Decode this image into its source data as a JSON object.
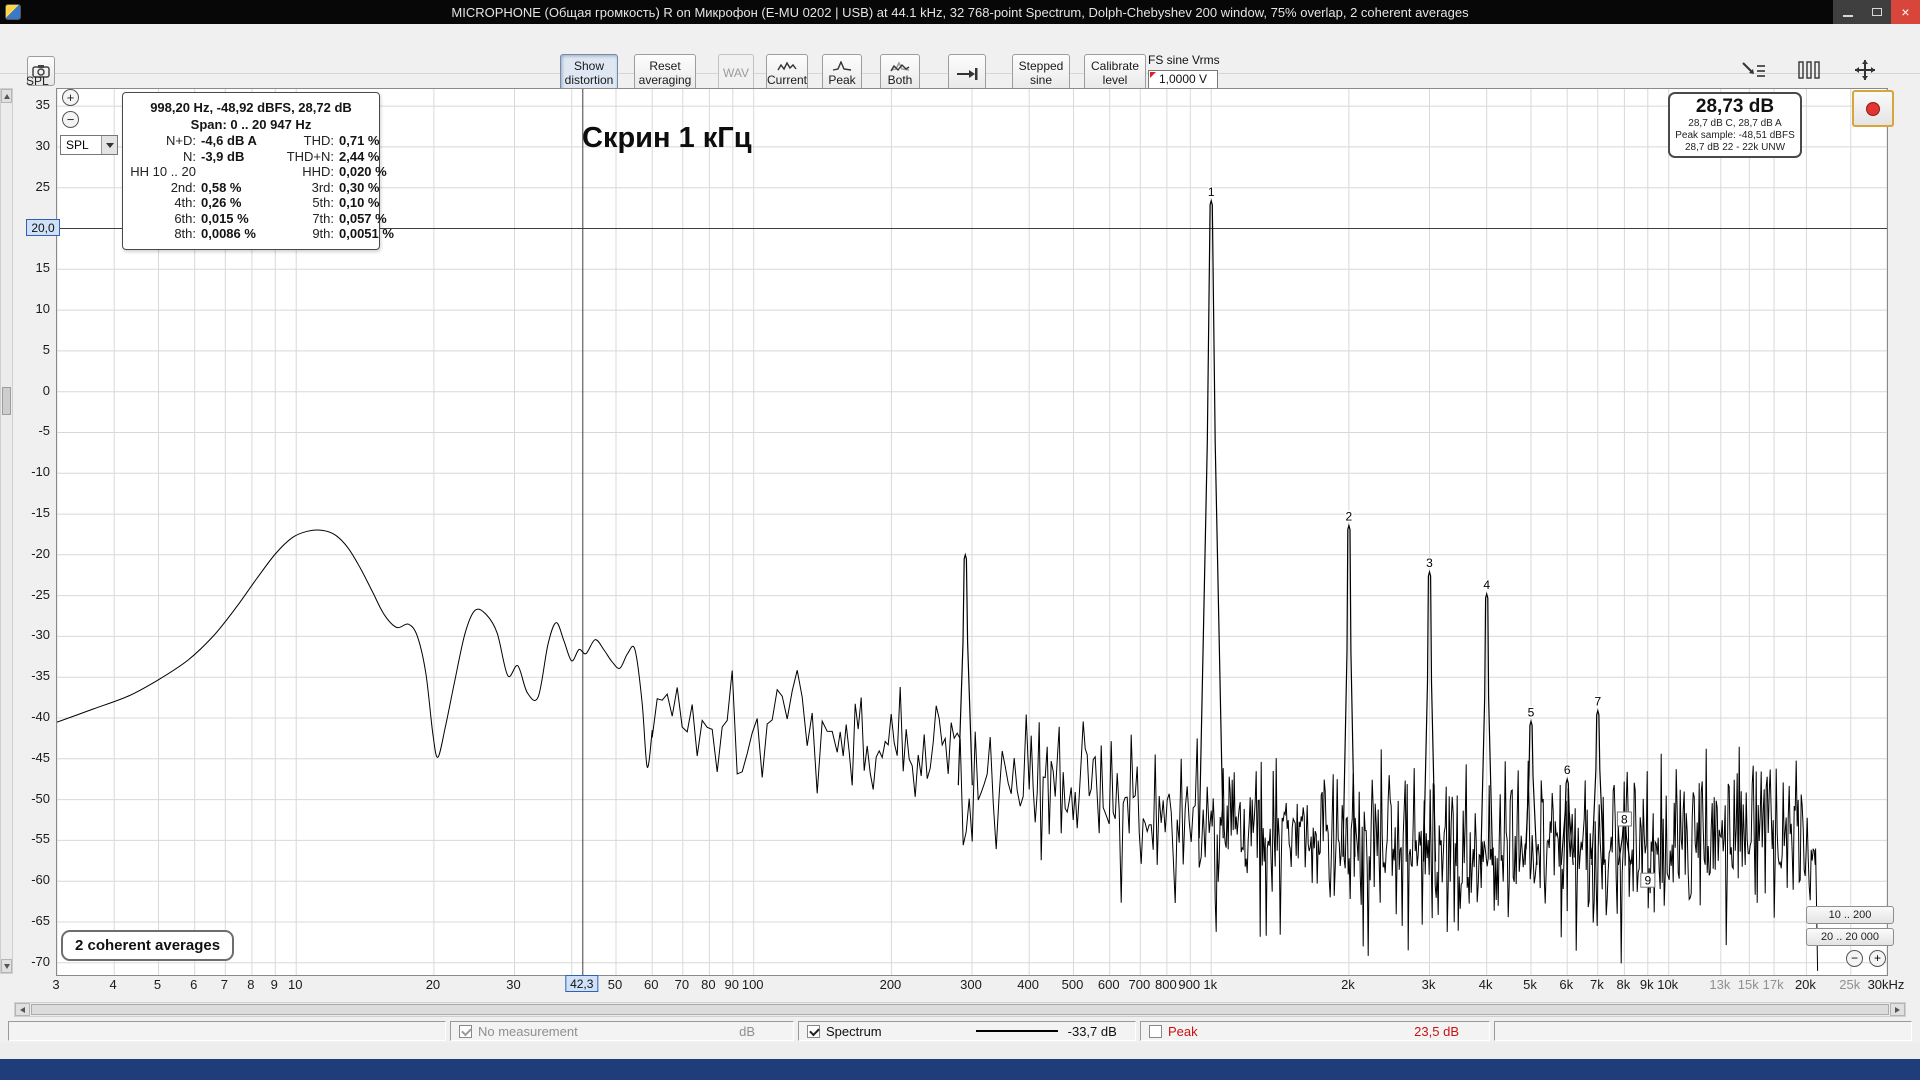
{
  "window": {
    "title": "MICROPHONE (Общая громкость) R on Микрофон (E-MU 0202 | USB) at 44.1 kHz, 32 768-point Spectrum, Dolph-Chebyshev 200 window, 75% overlap, 2 coherent averages"
  },
  "icons": {
    "close": "×",
    "plus": "+",
    "minus": "−"
  },
  "toolbar": {
    "buttons": {
      "show_distortion": "Show distortion",
      "reset_averaging": "Reset averaging",
      "wav": "WAV",
      "current": "Current",
      "peak": "Peak",
      "both": "Both",
      "stepped_sine": "Stepped sine",
      "calibrate_level": "Calibrate level"
    },
    "fs_sine_label": "FS sine Vrms",
    "fs_sine_value": "1,0000 V"
  },
  "left_panel": {
    "axis_title": "SPL",
    "unit_value": "SPL"
  },
  "annotation": "Скрин 1 кГц",
  "averages_label": "2 coherent averages",
  "marker_box": {
    "line1": "998,20 Hz, -48,92 dBFS, 28,72 dB",
    "line2": "Span: 0 .. 20 947 Hz",
    "rows": [
      [
        "N+D:",
        "-4,6 dB A",
        "THD:",
        "0,71 %"
      ],
      [
        "N:",
        "-3,9 dB",
        "THD+N:",
        "2,44 %"
      ],
      [
        "HH 10 .. 20",
        "",
        "HHD:",
        "0,020 %"
      ],
      [
        "2nd:",
        "0,58 %",
        "3rd:",
        "0,30 %"
      ],
      [
        "4th:",
        "0,26 %",
        "5th:",
        "0,10 %"
      ],
      [
        "6th:",
        "0,015 %",
        "7th:",
        "0,057 %"
      ],
      [
        "8th:",
        "0,0086 %",
        "9th:",
        "0,0051 %"
      ]
    ]
  },
  "level_box": {
    "main": "28,73 dB",
    "line1": "28,7 dB C, 28,7 dB A",
    "line2": "Peak sample: -48,51 dBFS",
    "line3": "28,7 dB 22 - 22k UNW"
  },
  "range_buttons": {
    "r1": "10 .. 200",
    "r2": "20 .. 20 000"
  },
  "status_bar": {
    "no_measurement": "No measurement",
    "db_label": "dB",
    "spectrum": "Spectrum",
    "spectrum_value": "-33,7 dB",
    "peak": "Peak",
    "peak_value": "23,5 dB"
  },
  "chart_data": {
    "type": "line",
    "title": "Скрин 1 кГц",
    "xlabel": "Hz",
    "ylabel": "SPL dB",
    "x_scale": "log",
    "x_range_hz": [
      3,
      30000
    ],
    "y_range_db": [
      -70,
      35
    ],
    "y_step_db": 5,
    "grid": true,
    "cursor": {
      "freq_hz": 42.3,
      "freq_label": "42,3",
      "level_db": 20.0,
      "level_label": "20,0"
    },
    "y_ticks": [
      35,
      30,
      25,
      15,
      10,
      5,
      0,
      -5,
      -10,
      -15,
      -20,
      -25,
      -30,
      -35,
      -40,
      -45,
      -50,
      -55,
      -60,
      -65,
      -70
    ],
    "x_ticks": [
      {
        "f": 3,
        "t": "3"
      },
      {
        "f": 4,
        "t": "4"
      },
      {
        "f": 5,
        "t": "5"
      },
      {
        "f": 6,
        "t": "6"
      },
      {
        "f": 7,
        "t": "7"
      },
      {
        "f": 8,
        "t": "8"
      },
      {
        "f": 9,
        "t": "9"
      },
      {
        "f": 10,
        "t": "10"
      },
      {
        "f": 20,
        "t": "20"
      },
      {
        "f": 30,
        "t": "30"
      },
      {
        "f": 50,
        "t": "50"
      },
      {
        "f": 60,
        "t": "60"
      },
      {
        "f": 70,
        "t": "70"
      },
      {
        "f": 80,
        "t": "80"
      },
      {
        "f": 90,
        "t": "90"
      },
      {
        "f": 100,
        "t": "100"
      },
      {
        "f": 200,
        "t": "200"
      },
      {
        "f": 300,
        "t": "300"
      },
      {
        "f": 400,
        "t": "400"
      },
      {
        "f": 500,
        "t": "500"
      },
      {
        "f": 600,
        "t": "600"
      },
      {
        "f": 700,
        "t": "700"
      },
      {
        "f": 800,
        "t": "800"
      },
      {
        "f": 900,
        "t": "900"
      },
      {
        "f": 1000,
        "t": "1k"
      },
      {
        "f": 2000,
        "t": "2k"
      },
      {
        "f": 3000,
        "t": "3k"
      },
      {
        "f": 4000,
        "t": "4k"
      },
      {
        "f": 5000,
        "t": "5k"
      },
      {
        "f": 6000,
        "t": "6k"
      },
      {
        "f": 7000,
        "t": "7k"
      },
      {
        "f": 8000,
        "t": "8k"
      },
      {
        "f": 9000,
        "t": "9k"
      },
      {
        "f": 10000,
        "t": "10k"
      },
      {
        "f": 13000,
        "t": "13k",
        "muted": true
      },
      {
        "f": 15000,
        "t": "15k",
        "muted": true
      },
      {
        "f": 17000,
        "t": "17k",
        "muted": true
      },
      {
        "f": 20000,
        "t": "20k"
      },
      {
        "f": 25000,
        "t": "25k",
        "muted": true
      },
      {
        "f": 30000,
        "t": "30kHz"
      }
    ],
    "harmonics": [
      {
        "n": "1",
        "f": 1000,
        "db": 23.4,
        "boxed": false
      },
      {
        "n": "2",
        "f": 2000,
        "db": -16.4,
        "boxed": false
      },
      {
        "n": "3",
        "f": 3000,
        "db": -22.1,
        "boxed": false
      },
      {
        "n": "4",
        "f": 4000,
        "db": -24.8,
        "boxed": false
      },
      {
        "n": "5",
        "f": 5000,
        "db": -40.4,
        "boxed": false
      },
      {
        "n": "6",
        "f": 6000,
        "db": -47.5,
        "boxed": false
      },
      {
        "n": "7",
        "f": 7000,
        "db": -39.1,
        "boxed": false
      },
      {
        "n": "8",
        "f": 8000,
        "db": -52.5,
        "boxed": true
      },
      {
        "n": "9",
        "f": 9000,
        "db": -60.0,
        "boxed": true
      }
    ],
    "spurs": [
      [
        290,
        -20.0
      ]
    ],
    "smooth_curve": [
      [
        3,
        -40.5
      ],
      [
        3.6,
        -38.9
      ],
      [
        4.3,
        -37.3
      ],
      [
        5,
        -35.3
      ],
      [
        5.8,
        -32.9
      ],
      [
        6.6,
        -29.9
      ],
      [
        7.4,
        -26.4
      ],
      [
        8.2,
        -22.9
      ],
      [
        9,
        -19.9
      ],
      [
        9.8,
        -17.9
      ],
      [
        10.6,
        -17.1
      ],
      [
        11.4,
        -17
      ],
      [
        12.2,
        -17.6
      ],
      [
        13,
        -19.2
      ],
      [
        13.8,
        -21.6
      ],
      [
        14.7,
        -24.6
      ],
      [
        15.6,
        -27.4
      ],
      [
        16.6,
        -28.9
      ],
      [
        17.6,
        -28.5
      ],
      [
        18.4,
        -30
      ],
      [
        19.2,
        -34.5
      ],
      [
        19.9,
        -42
      ],
      [
        20.4,
        -44.8
      ],
      [
        21.2,
        -41
      ],
      [
        22.2,
        -35.5
      ],
      [
        23.4,
        -29.6
      ],
      [
        24.6,
        -26.8
      ],
      [
        26,
        -27.3
      ],
      [
        27.5,
        -29.6
      ],
      [
        29,
        -34.8
      ],
      [
        30.5,
        -33.6
      ],
      [
        32,
        -36.9
      ],
      [
        33.8,
        -37.4
      ],
      [
        35.5,
        -31
      ],
      [
        37,
        -28.3
      ],
      [
        38.5,
        -30.6
      ],
      [
        40,
        -33
      ],
      [
        41.5,
        -31.6
      ],
      [
        43,
        -32.1
      ],
      [
        45,
        -30.4
      ],
      [
        47,
        -31.6
      ],
      [
        49,
        -33.1
      ],
      [
        51,
        -33.9
      ],
      [
        53,
        -32.1
      ],
      [
        55,
        -31.6
      ],
      [
        57,
        -38
      ],
      [
        58.5,
        -46
      ],
      [
        60,
        -41.5
      ]
    ],
    "noise_envelope": [
      [
        60,
        -38,
        7
      ],
      [
        80,
        -40,
        7.5
      ],
      [
        100,
        -41,
        8
      ],
      [
        140,
        -42,
        8
      ],
      [
        200,
        -44,
        8
      ],
      [
        280,
        -45,
        8
      ],
      [
        350,
        -46.5,
        8
      ],
      [
        500,
        -49,
        8
      ],
      [
        700,
        -51,
        8.5
      ],
      [
        900,
        -52,
        9
      ],
      [
        1200,
        -54,
        9
      ],
      [
        2000,
        -55,
        9.5
      ],
      [
        4000,
        -56,
        10
      ],
      [
        8000,
        -56,
        10
      ],
      [
        14000,
        -55,
        10
      ],
      [
        19000,
        -54,
        10
      ],
      [
        20947,
        -53,
        10
      ]
    ],
    "cutoff_hz": 20947,
    "averages": "2 coherent averages"
  }
}
